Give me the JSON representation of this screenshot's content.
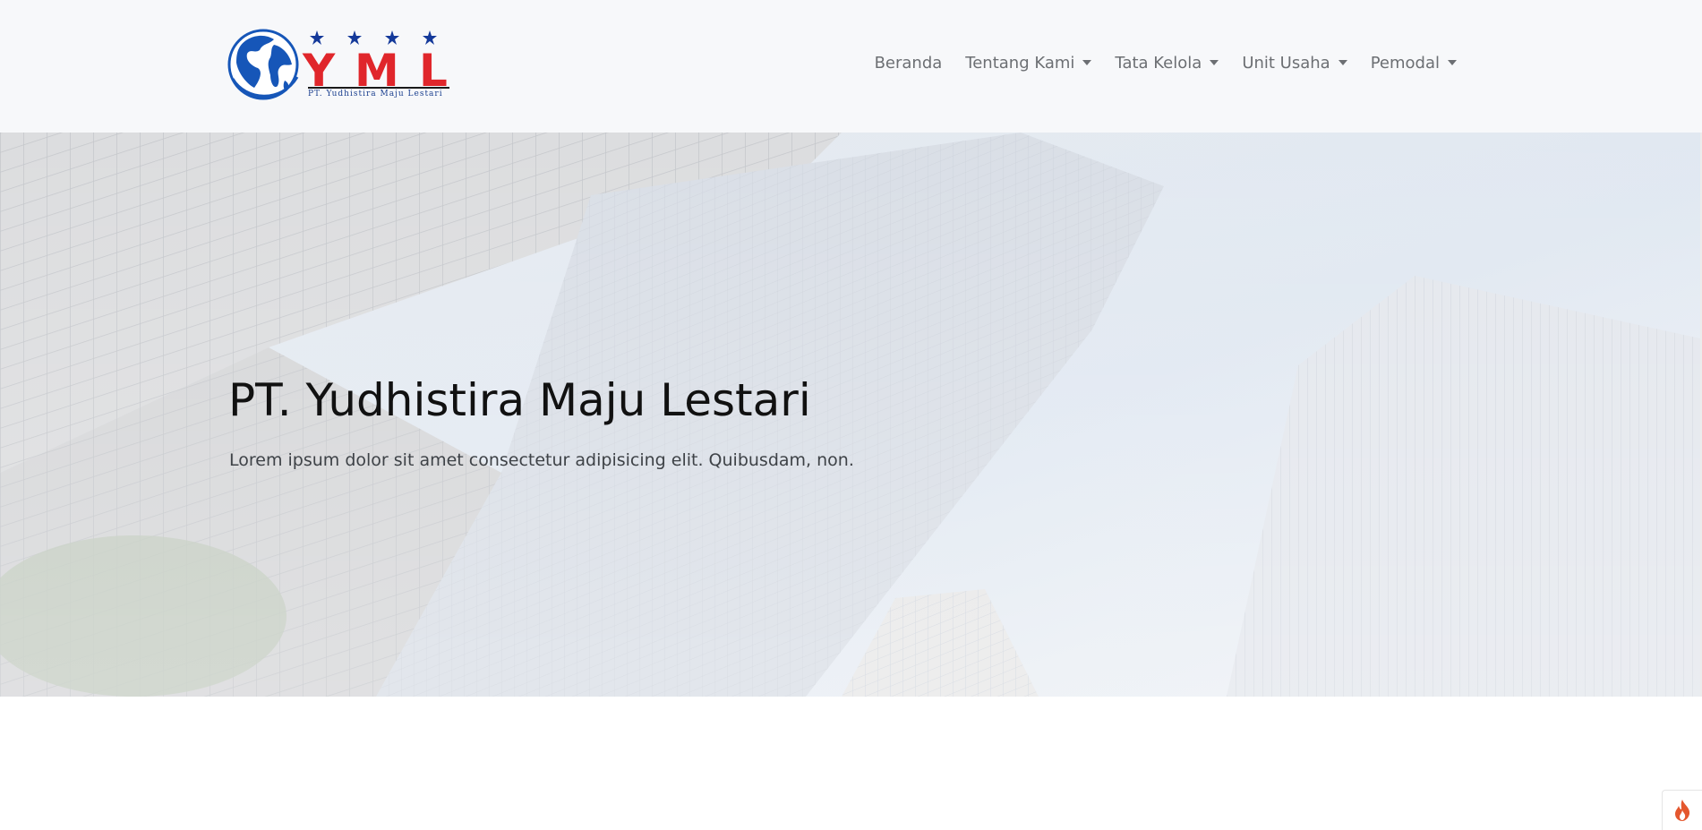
{
  "brand": {
    "logo_letters": "YML",
    "logo_name": "PT. Yudhistira Maju Lestari",
    "colors": {
      "globe": "#1656b8",
      "letters": "#e0262b",
      "stars": "#14399a"
    }
  },
  "nav": {
    "items": [
      {
        "label": "Beranda",
        "dropdown": false
      },
      {
        "label": "Tentang Kami",
        "dropdown": true
      },
      {
        "label": "Tata Kelola",
        "dropdown": true
      },
      {
        "label": "Unit Usaha",
        "dropdown": true
      },
      {
        "label": "Pemodal",
        "dropdown": true
      }
    ]
  },
  "hero": {
    "title": "PT. Yudhistira Maju Lestari",
    "subtitle": "Lorem ipsum dolor sit amet consectetur adipisicing elit. Quibusdam, non."
  },
  "widgets": {
    "corner_icon": "flame-icon",
    "corner_icon_color": "#e4572e"
  }
}
